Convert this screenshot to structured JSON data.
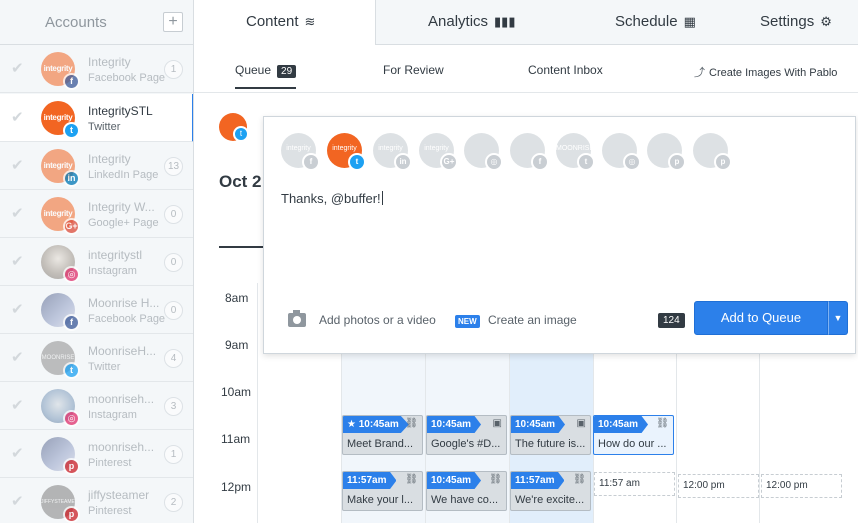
{
  "sidebar": {
    "title": "Accounts",
    "add_label": "+",
    "accounts": [
      {
        "name": "Integrity",
        "type": "Facebook Page",
        "count": "1",
        "network": "facebook-icon",
        "avatar_text": "integrity"
      },
      {
        "name": "IntegritySTL",
        "type": "Twitter",
        "count": "",
        "network": "twitter-icon",
        "avatar_text": "integrity"
      },
      {
        "name": "Integrity",
        "type": "LinkedIn Page",
        "count": "13",
        "network": "linkedin-icon",
        "avatar_text": "integrity"
      },
      {
        "name": "Integrity W...",
        "type": "Google+ Page",
        "count": "0",
        "network": "googleplus-icon",
        "avatar_text": "integrity"
      },
      {
        "name": "integritystl",
        "type": "Instagram",
        "count": "0",
        "network": "instagram-icon",
        "avatar_text": ""
      },
      {
        "name": "Moonrise H...",
        "type": "Facebook Page",
        "count": "0",
        "network": "facebook-icon",
        "avatar_text": ""
      },
      {
        "name": "MoonriseH...",
        "type": "Twitter",
        "count": "4",
        "network": "twitter-icon",
        "avatar_text": "MOONRISE"
      },
      {
        "name": "moonriseh...",
        "type": "Instagram",
        "count": "3",
        "network": "instagram-icon",
        "avatar_text": ""
      },
      {
        "name": "moonriseh...",
        "type": "Pinterest",
        "count": "1",
        "network": "pinterest-icon",
        "avatar_text": ""
      },
      {
        "name": "jiffysteamer",
        "type": "Pinterest",
        "count": "2",
        "network": "pinterest-icon",
        "avatar_text": "JIFFYSTEAMER"
      }
    ]
  },
  "top_tabs": [
    {
      "label": "Content",
      "icon": "layers-icon"
    },
    {
      "label": "Analytics",
      "icon": "bar-chart-icon"
    },
    {
      "label": "Schedule",
      "icon": "calendar-icon"
    },
    {
      "label": "Settings",
      "icon": "gear-icon"
    }
  ],
  "sub_tabs": {
    "queue": "Queue",
    "queue_count": "29",
    "for_review": "For Review",
    "content_inbox": "Content Inbox",
    "pablo": "Create Images With Pablo"
  },
  "main": {
    "date_heading": "Oct 2"
  },
  "composer": {
    "profile_badges": [
      "facebook-icon",
      "twitter-icon",
      "linkedin-icon",
      "googleplus-icon",
      "instagram-icon",
      "facebook-icon",
      "twitter-icon",
      "instagram-icon",
      "pinterest-icon",
      "pinterest-icon"
    ],
    "profile_texts": [
      "integrity",
      "integrity",
      "integrity",
      "integrity",
      "",
      "",
      "MOONRISE",
      "",
      "",
      ""
    ],
    "text": "Thanks, @buffer!",
    "add_media": "Add photos or a video",
    "new_badge": "NEW",
    "create_image": "Create an image",
    "char_count": "124",
    "add_to_queue": "Add to Queue"
  },
  "calendar": {
    "times": [
      "8am",
      "9am",
      "10am",
      "11am",
      "12pm"
    ],
    "posts_11": [
      {
        "time": "10:45am",
        "text": "Meet Brand..."
      },
      {
        "time": "10:45am",
        "text": "Google's #D..."
      },
      {
        "time": "10:45am",
        "text": "The future is..."
      },
      {
        "time": "10:45am",
        "text": "How do our ..."
      }
    ],
    "posts_12": [
      {
        "time": "11:57am",
        "text": "Make your l..."
      },
      {
        "time": "10:45am",
        "text": "We have co..."
      },
      {
        "time": "11:57am",
        "text": "We're excite..."
      }
    ],
    "slots_12": [
      "11:57 am",
      "12:00 pm",
      "12:00 pm"
    ]
  },
  "colors": {
    "accent": "#2c80ea",
    "brand_orange": "#f26522",
    "sidebar_bg": "#f4f7f9"
  }
}
